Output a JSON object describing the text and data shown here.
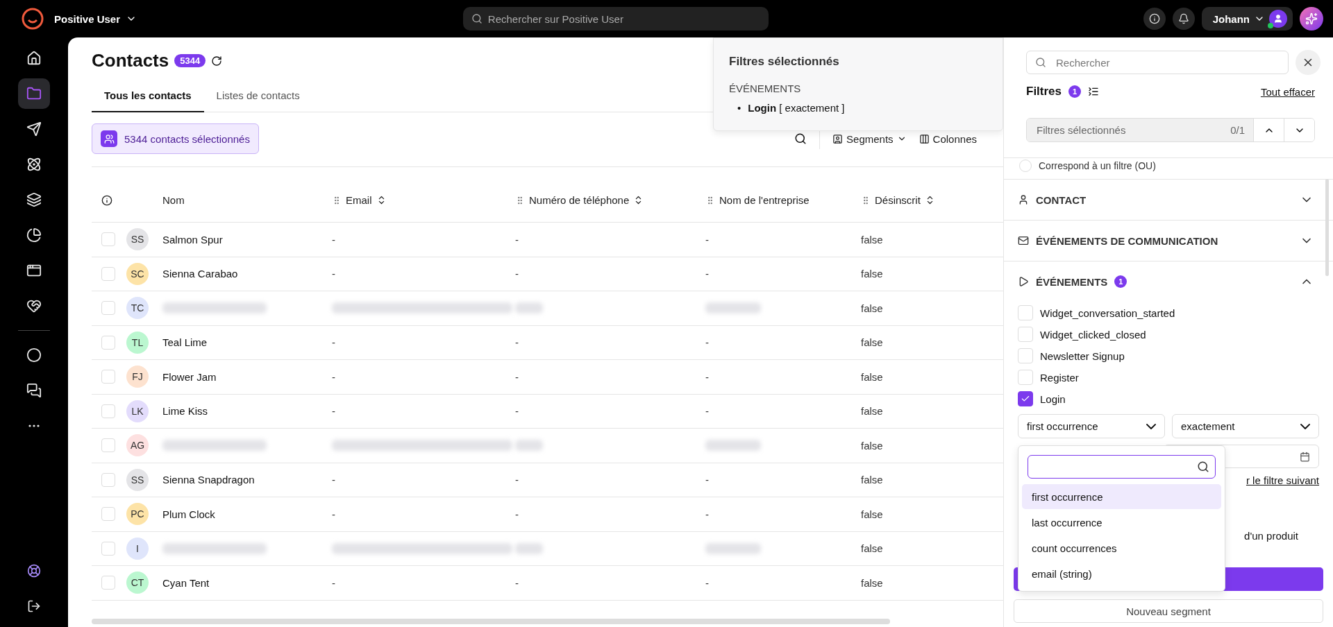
{
  "topbar": {
    "workspace": "Positive User",
    "search": {
      "placeholder": "Rechercher sur Positive User"
    },
    "user": "Johann"
  },
  "sidebar": {
    "items": [
      {
        "selected": false
      },
      {
        "selected": true
      },
      {
        "selected": false
      },
      {
        "selected": false
      },
      {
        "selected": false
      },
      {
        "selected": false
      },
      {
        "selected": false
      },
      {
        "selected": false
      }
    ],
    "more_items": [
      {
        "selected": false
      },
      {
        "selected": false
      },
      {
        "selected": false
      }
    ]
  },
  "page": {
    "title": "Contacts",
    "count": "5344",
    "tabs": [
      {
        "label": "Tous les contacts",
        "selected": true
      },
      {
        "label": "Listes de contacts",
        "selected": false
      }
    ],
    "selection": "5344 contacts sélectionnés",
    "toolbar": [
      "Segments",
      "Colonnes"
    ]
  },
  "popover": {
    "title": "Filtres sélectionnés",
    "section": "ÉVÉNEMENTS",
    "items": [
      {
        "bullet": "•",
        "text": "**Login** [ exactement ]"
      }
    ]
  },
  "table": {
    "columns": [
      "Nom",
      "Email",
      "Numéro de téléphone",
      "Nom de l'entreprise",
      "Désinscrit"
    ],
    "rows": [
      {
        "checked": false,
        "initials": "SS",
        "color": "#e4e4e7",
        "name": "Salmon Spur",
        "email": "-",
        "phone": "-",
        "company": "-",
        "unsubscribed": "false",
        "redacted": false
      },
      {
        "checked": false,
        "initials": "SC",
        "color": "#fde3a7",
        "name": "Sienna Carabao",
        "email": "-",
        "phone": "-",
        "company": "-",
        "unsubscribed": "false",
        "redacted": false
      },
      {
        "checked": false,
        "initials": "TC",
        "color": "#dfe5fb",
        "unsubscribed": "false",
        "redacted": true
      },
      {
        "checked": false,
        "initials": "TL",
        "color": "#bbf7d0",
        "name": "Teal Lime",
        "email": "-",
        "phone": "-",
        "company": "-",
        "unsubscribed": "false",
        "redacted": false
      },
      {
        "checked": false,
        "initials": "FJ",
        "color": "#fde2cf",
        "name": "Flower Jam",
        "email": "-",
        "phone": "-",
        "company": "-",
        "unsubscribed": "false",
        "redacted": false
      },
      {
        "checked": false,
        "initials": "LK",
        "color": "#e3dcfc",
        "name": "Lime Kiss",
        "email": "-",
        "phone": "-",
        "company": "-",
        "unsubscribed": "false",
        "redacted": false
      },
      {
        "checked": false,
        "initials": "AG",
        "color": "#fde0e0",
        "unsubscribed": "false",
        "redacted": true
      },
      {
        "checked": false,
        "initials": "SS",
        "color": "#e4e4e7",
        "name": "Sienna Snapdragon",
        "email": "-",
        "phone": "-",
        "company": "-",
        "unsubscribed": "false",
        "redacted": false
      },
      {
        "checked": false,
        "initials": "PC",
        "color": "#fde3a7",
        "name": "Plum Clock",
        "email": "-",
        "phone": "-",
        "company": "-",
        "unsubscribed": "false",
        "redacted": false
      },
      {
        "checked": false,
        "initials": "I",
        "color": "#dfe5fb",
        "unsubscribed": "false",
        "redacted": true
      },
      {
        "checked": false,
        "initials": "CT",
        "color": "#bbf7d0",
        "name": "Cyan Tent",
        "email": "-",
        "phone": "-",
        "company": "-",
        "unsubscribed": "false",
        "redacted": false
      }
    ]
  },
  "filters": {
    "search": {
      "placeholder": "Rechercher"
    },
    "title": "Filtres",
    "count": "1",
    "clear": "Tout effacer",
    "navigator": {
      "label": "Filtres sélectionnés",
      "position": "0/1"
    },
    "match_option": "Correspond à un filtre (OU)",
    "match_selected": false,
    "sections": [
      {
        "title": "CONTACT",
        "expanded": false
      },
      {
        "title": "ÉVÉNEMENTS DE COMMUNICATION",
        "expanded": false
      },
      {
        "title": "ÉVÉNEMENTS",
        "count": "1",
        "expanded": true,
        "options": [
          {
            "label": "Widget_conversation_started",
            "checked": false
          },
          {
            "label": "Widget_clicked_closed",
            "checked": false
          },
          {
            "label": "Newsletter Signup",
            "checked": false
          },
          {
            "label": "Register",
            "checked": false
          },
          {
            "label": "Login",
            "checked": true
          }
        ]
      }
    ],
    "property_select": "first occurrence",
    "operator_select": "exactement",
    "link_fragment": "r le filtre suivant",
    "text_fragment": "d'un produit",
    "dropdown": [
      {
        "label": "first occurrence",
        "selected": true
      },
      {
        "label": "last occurrence",
        "selected": false
      },
      {
        "label": "count occurrences",
        "selected": false
      },
      {
        "label": "email (string)",
        "selected": false
      }
    ],
    "secondary_button": "Nouveau segment"
  }
}
